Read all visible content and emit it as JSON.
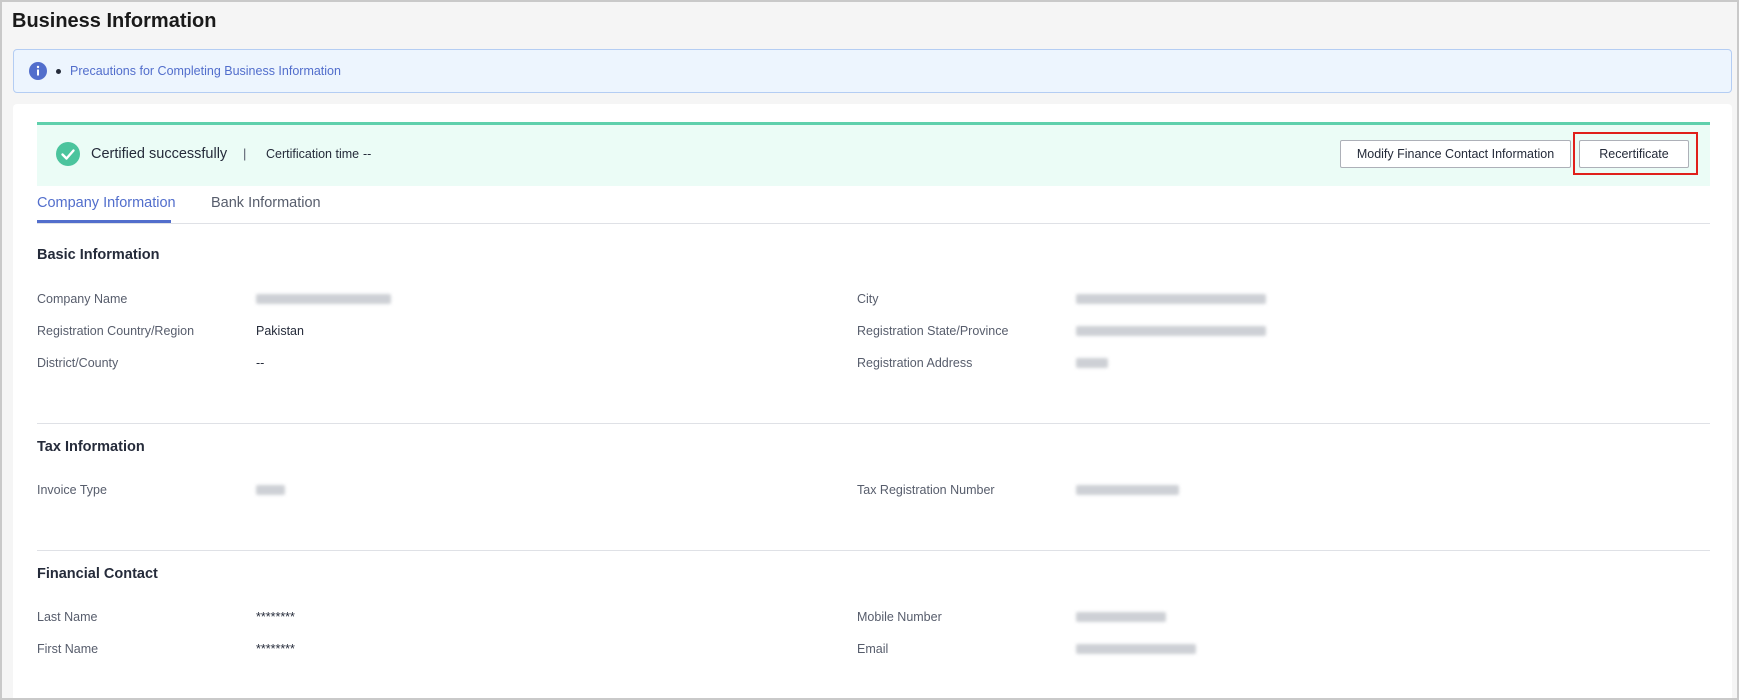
{
  "page": {
    "title": "Business Information"
  },
  "notice": {
    "link_text": "Precautions for Completing Business Information"
  },
  "status": {
    "text": "Certified successfully",
    "separator": "|",
    "time_label": "Certification time",
    "time_value": "--"
  },
  "actions": {
    "modify_label": "Modify Finance Contact Information",
    "recertificate_label": "Recertificate"
  },
  "tabs": [
    {
      "label": "Company Information",
      "active": true
    },
    {
      "label": "Bank Information",
      "active": false
    }
  ],
  "basic": {
    "title": "Basic Information",
    "company_name_label": "Company Name",
    "country_label": "Registration Country/Region",
    "country_value": "Pakistan",
    "district_label": "District/County",
    "district_value": "--",
    "city_label": "City",
    "state_label": "Registration State/Province",
    "address_label": "Registration Address"
  },
  "tax": {
    "title": "Tax Information",
    "invoice_type_label": "Invoice Type",
    "tax_reg_label": "Tax Registration Number"
  },
  "contact": {
    "title": "Financial Contact",
    "last_name_label": "Last Name",
    "last_name_value": "********",
    "first_name_label": "First Name",
    "first_name_value": "********",
    "mobile_label": "Mobile Number",
    "email_label": "Email"
  },
  "colors": {
    "accent": "#526ecc",
    "success": "#4bc49d",
    "success_bg": "#ebfcf6",
    "highlight": "#e0201b"
  }
}
